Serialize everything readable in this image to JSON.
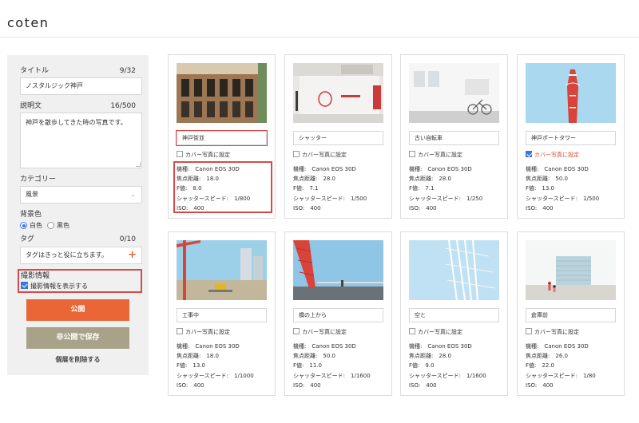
{
  "app": {
    "logo": "coten"
  },
  "form": {
    "title_label": "タイトル",
    "title_count": "9/32",
    "title_value": "ノスタルジック神戸",
    "desc_label": "説明文",
    "desc_count": "16/500",
    "desc_value": "神戸を散歩してきた時の写真です。",
    "category_label": "カテゴリー",
    "category_value": "風景",
    "bg_label": "背景色",
    "bg_options": [
      "白色",
      "黒色"
    ],
    "bg_selected": "白色",
    "tag_label": "タグ",
    "tag_count": "0/10",
    "tag_placeholder": "タグはきっと役に立ちます。",
    "shooting_label": "撮影情報",
    "shooting_checkbox": "撮影情報を表示する",
    "shooting_checked": true,
    "publish_button": "公開",
    "private_button": "非公開で保存",
    "delete_link": "個展を削除する"
  },
  "info_labels": {
    "camera": "機種:",
    "focal": "焦点距離:",
    "fnum": "F値:",
    "shutter": "シャッタースピード:",
    "iso": "ISO:"
  },
  "cover_label": "カバー写真に設定",
  "photos": [
    {
      "title": "神戸街並",
      "cover": false,
      "camera": "Canon EOS 30D",
      "focal": "18.0",
      "fnum": "8.0",
      "shutter": "1/800",
      "iso": "400"
    },
    {
      "title": "シャッター",
      "cover": false,
      "camera": "Canon EOS 30D",
      "focal": "28.0",
      "fnum": "7.1",
      "shutter": "1/500",
      "iso": "400"
    },
    {
      "title": "古い自転車",
      "cover": false,
      "camera": "Canon EOS 30D",
      "focal": "28.0",
      "fnum": "7.1",
      "shutter": "1/250",
      "iso": "400"
    },
    {
      "title": "神戸ポートタワー",
      "cover": true,
      "camera": "Canon EOS 30D",
      "focal": "50.0",
      "fnum": "13.0",
      "shutter": "1/500",
      "iso": "400"
    },
    {
      "title": "工事中",
      "cover": false,
      "camera": "Canon EOS 30D",
      "focal": "18.0",
      "fnum": "13.0",
      "shutter": "1/1000",
      "iso": "400"
    },
    {
      "title": "橋の上から",
      "cover": false,
      "camera": "Canon EOS 30D",
      "focal": "50.0",
      "fnum": "11.0",
      "shutter": "1/1600",
      "iso": "400"
    },
    {
      "title": "空と",
      "cover": false,
      "camera": "Canon EOS 30D",
      "focal": "28.0",
      "fnum": "9.0",
      "shutter": "1/1600",
      "iso": "400"
    },
    {
      "title": "倉庫前",
      "cover": false,
      "camera": "Canon EOS 30D",
      "focal": "26.0",
      "fnum": "22.0",
      "shutter": "1/80",
      "iso": "400"
    }
  ],
  "colors": {
    "accent": "#ea6637",
    "secondary": "#a8a289",
    "highlight": "#d84a4a",
    "check": "#3a78d8"
  },
  "shop_sign": "scenery.info"
}
